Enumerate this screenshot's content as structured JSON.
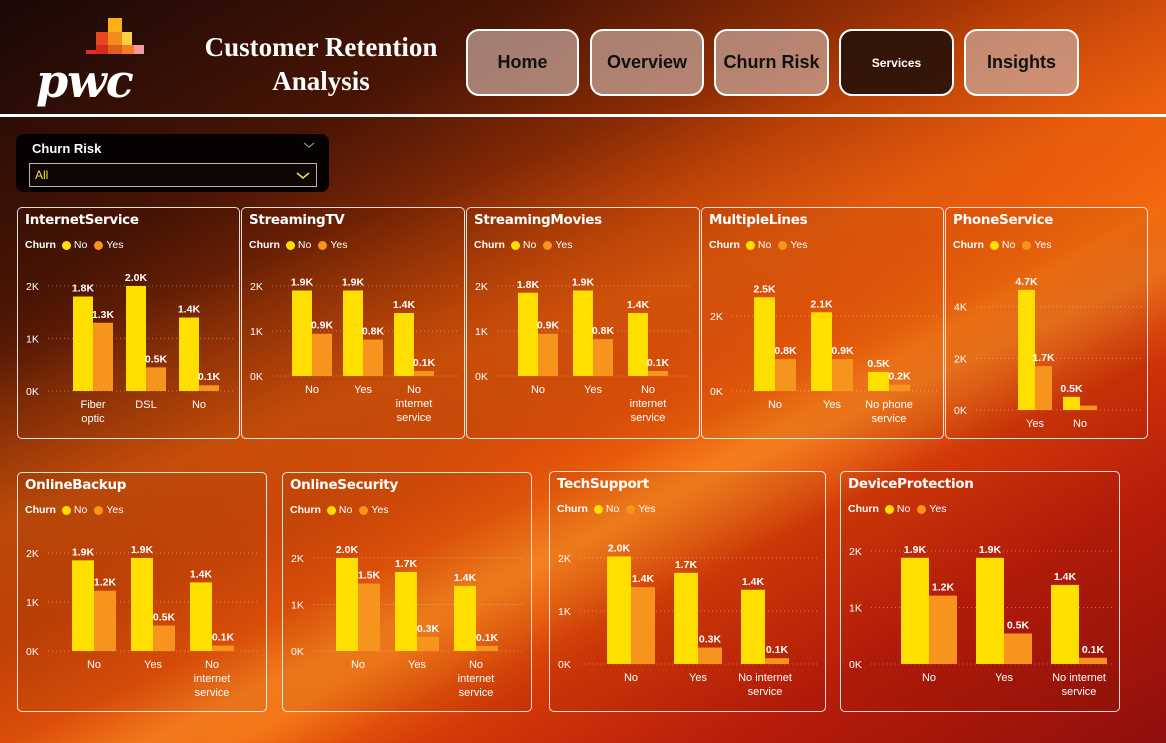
{
  "header": {
    "logo_text": "pwc",
    "title_line1": "Customer Retention",
    "title_line2": "Analysis",
    "nav": [
      {
        "label": "Home",
        "active": false
      },
      {
        "label": "Overview",
        "active": false
      },
      {
        "label": "Churn Risk",
        "active": false
      },
      {
        "label": "Services",
        "active": true
      },
      {
        "label": "Insights",
        "active": false
      }
    ]
  },
  "slicer": {
    "title": "Churn Risk",
    "value": "All"
  },
  "colors": {
    "no": "#ffdf00",
    "yes": "#f7941d",
    "tick": "#ffffff"
  },
  "legend": {
    "title": "Churn",
    "no": "No",
    "yes": "Yes"
  },
  "charts": [
    {
      "id": "internetservice",
      "title": "InternetService",
      "chart_data": {
        "type": "bar",
        "ylim": [
          0,
          2000
        ],
        "ticks": [
          "0K",
          "1K",
          "2K"
        ],
        "categories": [
          [
            "Fiber",
            "optic"
          ],
          [
            "DSL"
          ],
          [
            "No"
          ]
        ],
        "series": [
          {
            "name": "No",
            "values": [
              1800,
              2000,
              1400
            ],
            "labels": [
              "1.8K",
              "2.0K",
              "1.4K"
            ]
          },
          {
            "name": "Yes",
            "values": [
              1300,
              450,
              110
            ],
            "labels": [
              "1.3K",
              "0.5K",
              "0.1K"
            ]
          }
        ]
      }
    },
    {
      "id": "streamingtv",
      "title": "StreamingTV",
      "chart_data": {
        "type": "bar",
        "ylim": [
          0,
          2000
        ],
        "ticks": [
          "0K",
          "1K",
          "2K"
        ],
        "categories": [
          [
            "No"
          ],
          [
            "Yes"
          ],
          [
            "No",
            "internet",
            "service"
          ]
        ],
        "series": [
          {
            "name": "No",
            "values": [
              1900,
              1900,
              1400
            ],
            "labels": [
              "1.9K",
              "1.9K",
              "1.4K"
            ]
          },
          {
            "name": "Yes",
            "values": [
              940,
              810,
              110
            ],
            "labels": [
              "0.9K",
              "0.8K",
              "0.1K"
            ]
          }
        ]
      }
    },
    {
      "id": "streamingmovies",
      "title": "StreamingMovies",
      "chart_data": {
        "type": "bar",
        "ylim": [
          0,
          2000
        ],
        "ticks": [
          "0K",
          "1K",
          "2K"
        ],
        "categories": [
          [
            "No"
          ],
          [
            "Yes"
          ],
          [
            "No",
            "internet",
            "service"
          ]
        ],
        "series": [
          {
            "name": "No",
            "values": [
              1850,
              1900,
              1400
            ],
            "labels": [
              "1.8K",
              "1.9K",
              "1.4K"
            ]
          },
          {
            "name": "Yes",
            "values": [
              940,
              820,
              110
            ],
            "labels": [
              "0.9K",
              "0.8K",
              "0.1K"
            ]
          }
        ]
      }
    },
    {
      "id": "multiplelines",
      "title": "MultipleLines",
      "chart_data": {
        "type": "bar",
        "ylim": [
          0,
          2800
        ],
        "ticks": [
          "0K",
          "2K"
        ],
        "categories": [
          [
            "No"
          ],
          [
            "Yes"
          ],
          [
            "No phone",
            "service"
          ]
        ],
        "series": [
          {
            "name": "No",
            "values": [
              2500,
              2100,
              510
            ],
            "labels": [
              "2.5K",
              "2.1K",
              "0.5K"
            ]
          },
          {
            "name": "Yes",
            "values": [
              850,
              850,
              170
            ],
            "labels": [
              "0.8K",
              "0.9K",
              "0.2K"
            ]
          }
        ]
      }
    },
    {
      "id": "phoneservice",
      "title": "PhoneService",
      "chart_data": {
        "type": "bar",
        "ylim": [
          0,
          4800
        ],
        "ticks": [
          "0K",
          "2K",
          "4K"
        ],
        "categories": [
          [
            "Yes"
          ],
          [
            "No"
          ]
        ],
        "series": [
          {
            "name": "No",
            "values": [
              4650,
              510
            ],
            "labels": [
              "4.7K",
              "0.5K"
            ]
          },
          {
            "name": "Yes",
            "values": [
              1700,
              170
            ],
            "labels": [
              "1.7K",
              ""
            ]
          }
        ]
      }
    },
    {
      "id": "onlinebackup",
      "title": "OnlineBackup",
      "chart_data": {
        "type": "bar",
        "ylim": [
          0,
          2000
        ],
        "ticks": [
          "0K",
          "1K",
          "2K"
        ],
        "categories": [
          [
            "No"
          ],
          [
            "Yes"
          ],
          [
            "No",
            "internet",
            "service"
          ]
        ],
        "series": [
          {
            "name": "No",
            "values": [
              1850,
              1900,
              1400
            ],
            "labels": [
              "1.9K",
              "1.9K",
              "1.4K"
            ]
          },
          {
            "name": "Yes",
            "values": [
              1230,
              520,
              110
            ],
            "labels": [
              "1.2K",
              "0.5K",
              "0.1K"
            ]
          }
        ]
      }
    },
    {
      "id": "onlinesecurity",
      "title": "OnlineSecurity",
      "chart_data": {
        "type": "bar",
        "ylim": [
          0,
          2000
        ],
        "ticks": [
          "0K",
          "1K",
          "2K"
        ],
        "categories": [
          [
            "No"
          ],
          [
            "Yes"
          ],
          [
            "No",
            "internet",
            "service"
          ]
        ],
        "series": [
          {
            "name": "No",
            "values": [
              2000,
              1700,
              1400
            ],
            "labels": [
              "2.0K",
              "1.7K",
              "1.4K"
            ]
          },
          {
            "name": "Yes",
            "values": [
              1450,
              300,
              110
            ],
            "labels": [
              "1.5K",
              "0.3K",
              "0.1K"
            ]
          }
        ]
      }
    },
    {
      "id": "techsupport",
      "title": "TechSupport",
      "chart_data": {
        "type": "bar",
        "ylim": [
          0,
          2000
        ],
        "ticks": [
          "0K",
          "1K",
          "2K"
        ],
        "categories": [
          [
            "No"
          ],
          [
            "Yes"
          ],
          [
            "No internet",
            "service"
          ]
        ],
        "series": [
          {
            "name": "No",
            "values": [
              2030,
              1720,
              1400
            ],
            "labels": [
              "2.0K",
              "1.7K",
              "1.4K"
            ]
          },
          {
            "name": "Yes",
            "values": [
              1450,
              310,
              110
            ],
            "labels": [
              "1.4K",
              "0.3K",
              "0.1K"
            ]
          }
        ]
      }
    },
    {
      "id": "deviceprotection",
      "title": "DeviceProtection",
      "chart_data": {
        "type": "bar",
        "ylim": [
          0,
          2000
        ],
        "ticks": [
          "0K",
          "1K",
          "2K"
        ],
        "categories": [
          [
            "No"
          ],
          [
            "Yes"
          ],
          [
            "No internet",
            "service"
          ]
        ],
        "series": [
          {
            "name": "No",
            "values": [
              1880,
              1880,
              1400
            ],
            "labels": [
              "1.9K",
              "1.9K",
              "1.4K"
            ]
          },
          {
            "name": "Yes",
            "values": [
              1210,
              540,
              110
            ],
            "labels": [
              "1.2K",
              "0.5K",
              "0.1K"
            ]
          }
        ]
      }
    }
  ]
}
